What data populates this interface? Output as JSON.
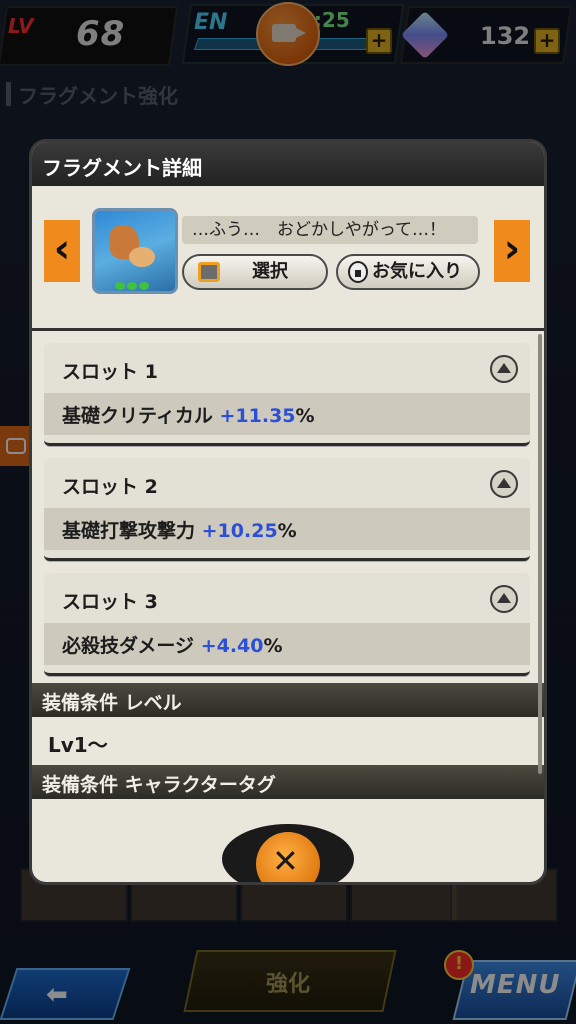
{
  "hud": {
    "level_label": "LV",
    "level_value": "68",
    "energy_label": "EN",
    "energy_timer": "5:25",
    "gems": "132"
  },
  "page_title": "フラグメント強化",
  "modal": {
    "title": "フラグメント詳細",
    "dialogue": "…ふう…　おどかしやがって…！",
    "select_label": "選択",
    "favorite_label": "お気に入り",
    "slots": [
      {
        "title": "スロット 1",
        "stat_name": "基礎クリティカル",
        "stat_value": "+11.35",
        "unit": "%"
      },
      {
        "title": "スロット 2",
        "stat_name": "基礎打撃攻撃力",
        "stat_value": "+10.25",
        "unit": "%"
      },
      {
        "title": "スロット 3",
        "stat_name": "必殺技ダメージ",
        "stat_value": "+4.40",
        "unit": "%"
      }
    ],
    "equip_level_header": "装備条件 レベル",
    "equip_level_value": "Lv1～",
    "equip_tag_header": "装備条件 キャラクタータグ"
  },
  "bottom": {
    "enhance_label": "強化",
    "menu_label": "MENU",
    "notif": "!"
  },
  "colors": {
    "accent_orange": "#f08a1c",
    "stat_blue": "#2d4fd6",
    "modal_bg": "#e9e6dc"
  }
}
